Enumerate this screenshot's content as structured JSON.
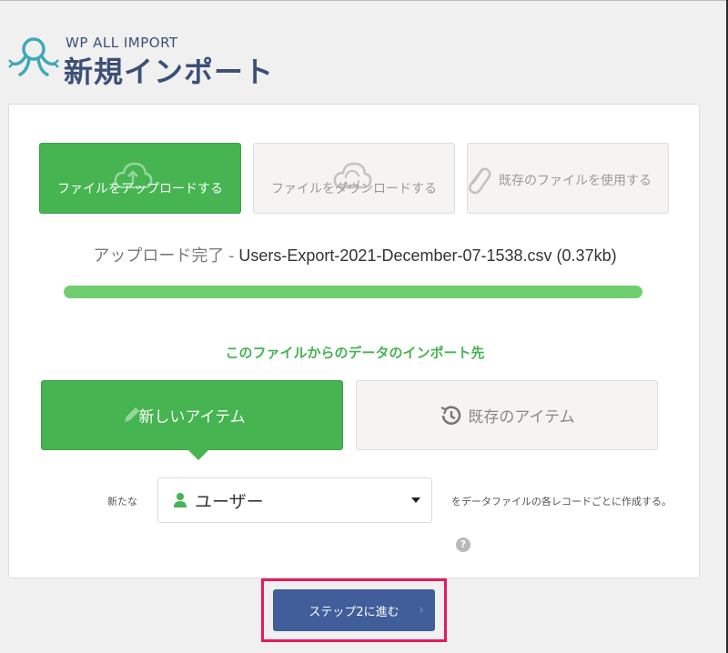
{
  "brand": {
    "small_title": "WP ALL IMPORT",
    "page_title": "新規インポート",
    "logo_icon": "octopus-logo-icon"
  },
  "colors": {
    "accent_green": "#46b450",
    "primary_blue": "#415d9a",
    "brand_navy": "#3c4f77",
    "highlight": "#e8195a"
  },
  "source_buttons": [
    {
      "label": "ファイルをアップロードする",
      "icon": "cloud-upload-icon",
      "active": true
    },
    {
      "label": "ファイルをダウンロードする",
      "icon": "cloud-sync-icon",
      "active": false
    },
    {
      "label": "既存のファイルを使用する",
      "icon": "paperclip-icon",
      "active": false
    }
  ],
  "upload_status": {
    "label": "アップロード完了",
    "separator": " - ",
    "filename": "Users-Export-2021-December-07-1538.csv",
    "size": "(0.37kb)",
    "progress_fraction": 1.0
  },
  "destination": {
    "heading": "このファイルからのデータのインポート先",
    "new_items_label": "新しいアイテム",
    "existing_items_label": "既存のアイテム",
    "selected": "new"
  },
  "post_type_row": {
    "prefix": "新たな",
    "selected_value": "ユーザー",
    "suffix": "をデータファイルの各レコードごとに作成する。",
    "help": "?"
  },
  "footer": {
    "next_button_label": "ステップ2に進む",
    "next_chevron": "›"
  }
}
